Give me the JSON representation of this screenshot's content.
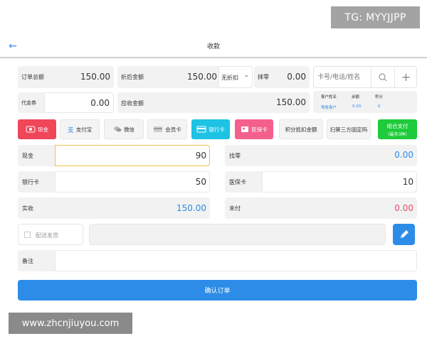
{
  "header": {
    "title": "收款"
  },
  "summary": {
    "order_total_label": "订单总额",
    "order_total_value": "150.00",
    "discount_amount_label": "折后金额",
    "discount_amount_value": "150.00",
    "discount_select": "无折扣",
    "round_off_label": "抹零",
    "round_off_value": "0.00",
    "member_search_placeholder": "卡号/电话/姓名",
    "voucher_label": "代金券",
    "voucher_value": "0.00",
    "receivable_label": "应收金额",
    "receivable_value": "150.00"
  },
  "member_table": {
    "headers": [
      "客户姓名",
      "余额",
      "积分"
    ],
    "row": [
      "零售客户",
      "0.00",
      "0"
    ]
  },
  "pay_methods": [
    {
      "label": "现金",
      "icon": "cash-icon"
    },
    {
      "label": "支付宝",
      "icon": "alipay-icon"
    },
    {
      "label": "微信",
      "icon": "wechat-icon"
    },
    {
      "label": "会员卡",
      "icon": "member-card-icon"
    },
    {
      "label": "银行卡",
      "icon": "bank-card-icon"
    },
    {
      "label": "医保卡",
      "icon": "medical-card-icon"
    },
    {
      "label": "积分抵扣金额",
      "icon": ""
    },
    {
      "label": "扫第三方固定码",
      "icon": ""
    },
    {
      "label": "组合支付",
      "sub": "(最多3种)",
      "icon": ""
    }
  ],
  "payments": {
    "cash_label": "现金",
    "cash_value": "90",
    "change_label": "找零",
    "change_value": "0.00",
    "bank_label": "银行卡",
    "bank_value": "50",
    "medical_label": "医保卡",
    "medical_value": "10",
    "received_label": "实收",
    "received_value": "150.00",
    "unpaid_label": "未付",
    "unpaid_value": "0.00"
  },
  "delivery": {
    "checkbox_label": "配送发货"
  },
  "remark": {
    "label": "备注"
  },
  "confirm": {
    "label": "确认订单"
  },
  "colors": {
    "primary": "#2d8ce8",
    "cash_red": "#f0465a",
    "bank_cyan": "#1ec3e3",
    "medical_pink": "#f45f8c",
    "combo_green": "#1ecb3a",
    "unpaid_red": "#e05070"
  },
  "watermarks": {
    "tg": "TG: MYYJJPP",
    "site": "www.zhcnjiuyou.com"
  }
}
